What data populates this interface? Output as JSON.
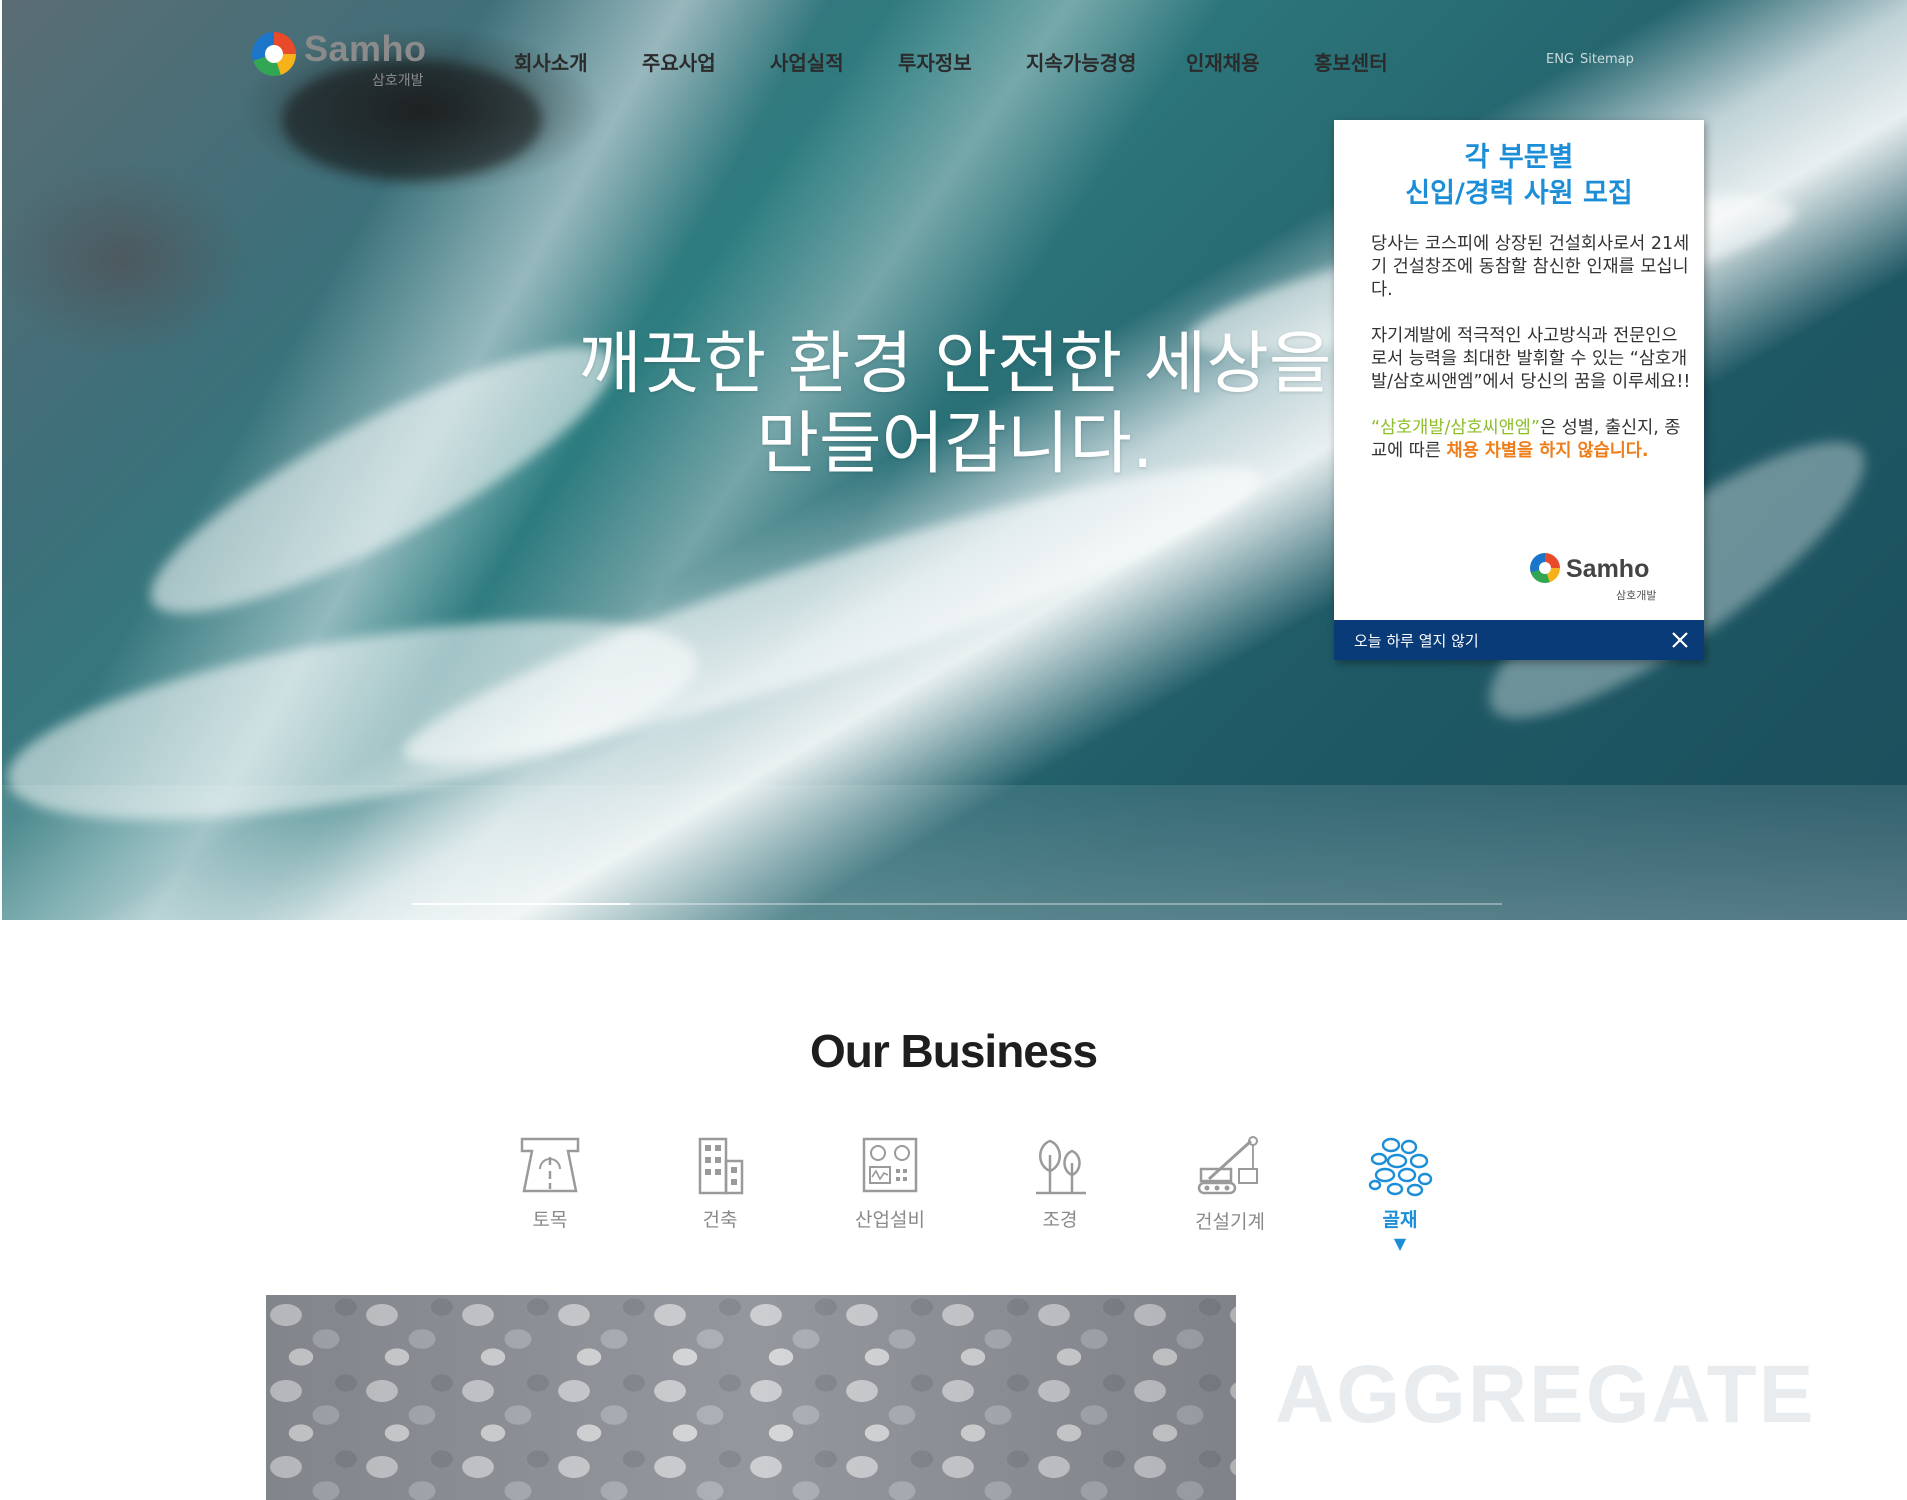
{
  "header": {
    "logo_text": "Samho",
    "logo_subtext": "삼호개발",
    "nav": [
      "회사소개",
      "주요사업",
      "사업실적",
      "투자정보",
      "지속가능경영",
      "인재채용",
      "홍보센터"
    ],
    "util_links": [
      "ENG",
      "Sitemap"
    ]
  },
  "hero": {
    "headline_line1": "깨끗한 환경 안전한 세상을",
    "headline_line2": "만들어갑니다.",
    "slide_progress": 0.2
  },
  "popup": {
    "title_line1": "각 부문별",
    "title_line2": "신입/경력 사원 모집",
    "para1": "당사는 코스피에 상장된 건설회사로서 21세기 건설창조에 동참할 참신한 인재를 모십니다.",
    "para2": "자기계발에 적극적인 사고방식과 전문인으로서 능력을 최대한 발휘할 수 있는 “삼호개발/삼호씨앤엠”에서 당신의 꿈을 이루세요!!",
    "para3_green": "“삼호개발/삼호씨앤엠”",
    "para3_text": "은 성별, 출신지, 종교에 따른 ",
    "para3_orange": "채용 차별을 하지 않습니다.",
    "logo_text": "Samho",
    "logo_subtext": "삼호개발",
    "dismiss_label": "오늘 하루 열지 않기",
    "footer_color": "#0a3b79",
    "title_color": "#1c8ed8"
  },
  "business": {
    "title": "Our Business",
    "tabs": [
      {
        "label": "토목",
        "icon": "road-tunnel-icon"
      },
      {
        "label": "건축",
        "icon": "building-icon"
      },
      {
        "label": "산업설비",
        "icon": "control-panel-icon"
      },
      {
        "label": "조경",
        "icon": "trees-icon"
      },
      {
        "label": "건설기계",
        "icon": "crane-icon"
      },
      {
        "label": "골재",
        "icon": "gravel-icon"
      }
    ],
    "active_tab": "골재",
    "active_caret": "▼",
    "feature_word": "AGGREGATE",
    "accent_color": "#1c8ed8"
  }
}
